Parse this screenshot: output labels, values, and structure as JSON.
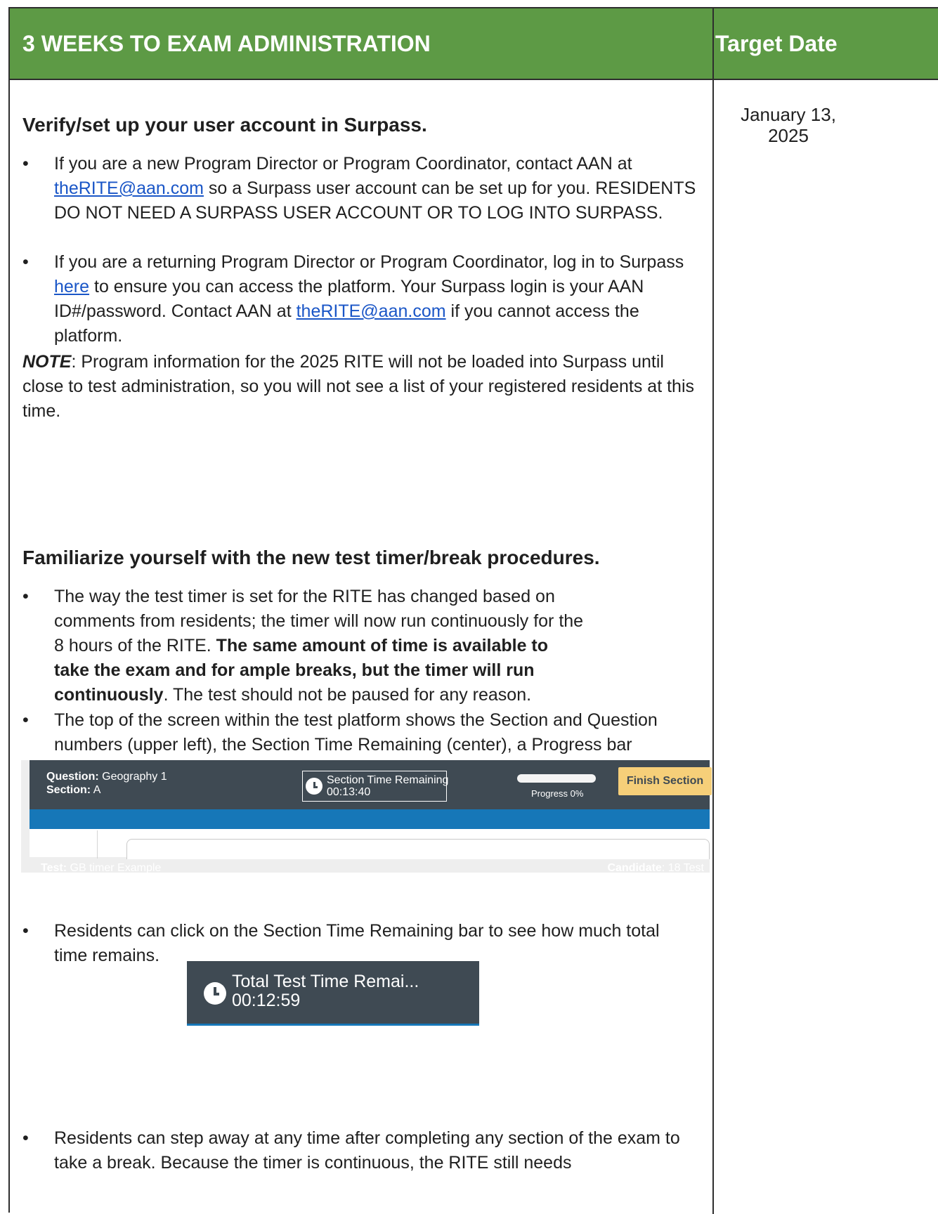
{
  "header": {
    "title": "3 WEEKS TO EXAM ADMINISTRATION",
    "target_label": "Target Date"
  },
  "target_date": {
    "line1": "January 13,",
    "line2": "2025"
  },
  "section1": {
    "heading": "Verify/set up your user account in Surpass.",
    "bullet1": {
      "t1": "If you are a new Program Director or Program Coordinator, contact AAN at ",
      "link": "theRITE@aan.com",
      "t2": " so a Surpass user account can be set up for you. RESIDENTS DO NOT NEED A SURPASS USER ACCOUNT OR TO LOG INTO SURPASS."
    },
    "bullet2": {
      "t1": "If you are a returning Program Director or Program Coordinator, log in to Surpass ",
      "link1": "here",
      "t2": " to ensure you can access the platform. Your Surpass login is your AAN ID#/password. Contact AAN at ",
      "link2": "theRITE@aan.com",
      "t3": " if you cannot access the platform."
    },
    "note_label": "NOTE",
    "note_text": ": Program information for the 2025 RITE will not be loaded into Surpass until close to test administration, so you will not see a list of your registered residents at this time."
  },
  "section2": {
    "heading": "Familiarize yourself with the new test timer/break procedures.",
    "bullet1": {
      "t1": "The way the test timer is set for the RITE has changed based on comments from residents; the timer will now run continuously for the 8 hours of the RITE. ",
      "bold": "The same amount of time is available to take the exam and for ample breaks, but the timer will run continuously",
      "t2": ". The test should not be paused for any reason."
    },
    "bullet2": "The top of the screen within the test platform shows the Section and Question numbers (upper left), the Section Time Remaining (center), a Progress bar (upper right), and the Finish Section bar. As in the past, once residents have completed a section of the RITE, they will not be able to go back to the completed section.",
    "bullet3": "Residents can click on the Section Time Remaining bar to see how much total time remains.",
    "bullet4": "Residents can step away at any time after completing any section of the exam to take a break. Because the timer is continuous, the RITE still needs"
  },
  "screenshot1": {
    "question_label": "Question:",
    "question_value": " Geography 1",
    "section_label": "Section:",
    "section_value": " A",
    "timer_title": "Section Time Remaining",
    "timer_value": "00:13:40",
    "progress_label": "Progress 0%",
    "progress_value": 0,
    "finish_button": "Finish Section",
    "test_label": "Test:",
    "test_value": " GB timer Example",
    "candidate_label": "Candidate",
    "candidate_value": ": 18 Test"
  },
  "screenshot2": {
    "timer_title": "Total Test Time Remai...",
    "timer_value": "00:12:59"
  },
  "colors": {
    "header_green": "#5d9a45",
    "bar_dark": "#3f4a53",
    "bar_blue": "#1677b8",
    "finish_yellow": "#f6cf79",
    "link_blue": "#1a56c7"
  }
}
